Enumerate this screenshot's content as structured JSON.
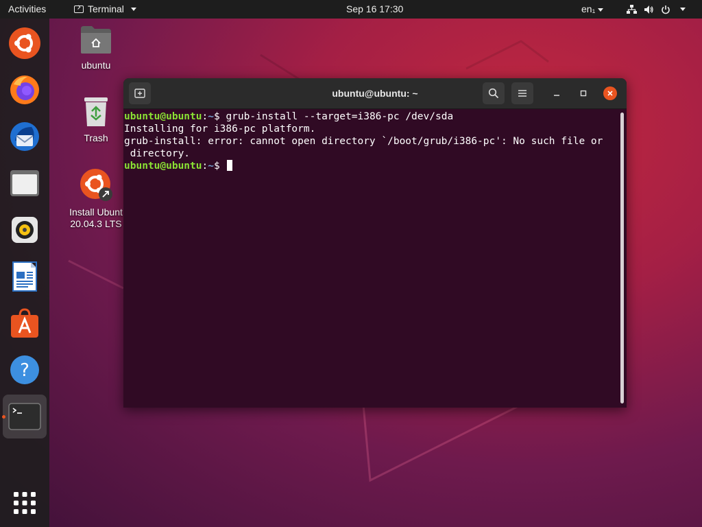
{
  "topbar": {
    "activities": "Activities",
    "app_name": "Terminal",
    "clock": "Sep 16  17:30",
    "language": "en₁"
  },
  "dock": {
    "items": [
      {
        "name": "Ubuntu"
      },
      {
        "name": "Firefox Web Browser"
      },
      {
        "name": "Thunderbird Mail"
      },
      {
        "name": "Files"
      },
      {
        "name": "Rhythmbox"
      },
      {
        "name": "LibreOffice Writer"
      },
      {
        "name": "Ubuntu Software"
      },
      {
        "name": "Help"
      },
      {
        "name": "Terminal",
        "running": true
      },
      {
        "name": "Show Applications"
      }
    ]
  },
  "desktop": {
    "home_label": "ubuntu",
    "trash_label": "Trash",
    "installer_label_line1": "Install Ubunt",
    "installer_label_line2": "20.04.3 LTS"
  },
  "terminal": {
    "title": "ubuntu@ubuntu: ~",
    "prompt_user": "ubuntu@ubuntu",
    "prompt_sep": ":",
    "prompt_path": "~",
    "prompt_symbol": "$ ",
    "command": "grub-install --target=i386-pc /dev/sda",
    "output_1": "Installing for i386-pc platform.",
    "output_2": "grub-install: error: cannot open directory `/boot/grub/i386-pc': No such file or",
    "output_3": " directory."
  },
  "colors": {
    "accent": "#e95420",
    "terminal_bg": "#300a24",
    "prompt_user": "#8ae234",
    "prompt_path": "#729fcf"
  }
}
